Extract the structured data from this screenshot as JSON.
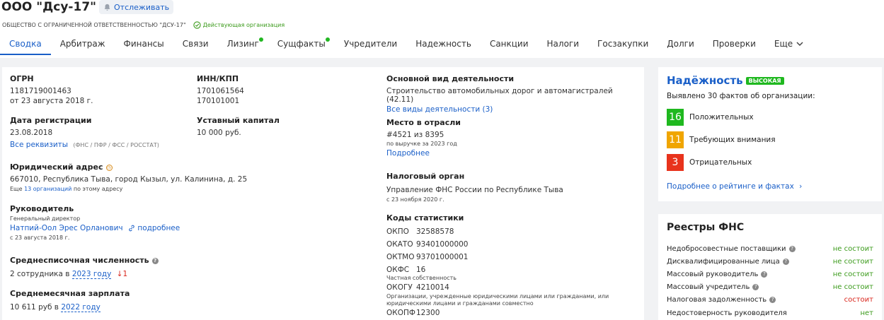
{
  "header": {
    "title": "ООО \"Дсу-17\"",
    "follow_label": "Отслеживать",
    "full_name": "ОБЩЕСТВО С ОГРАНИЧЕННОЙ ОТВЕТСТВЕННОСТЬЮ \"ДСУ-17\"",
    "status": "Действующая организация"
  },
  "tabs": [
    {
      "label": "Сводка",
      "active": true
    },
    {
      "label": "Арбитраж"
    },
    {
      "label": "Финансы"
    },
    {
      "label": "Связи"
    },
    {
      "label": "Лизинг",
      "dot": true
    },
    {
      "label": "Сущфакты",
      "dot": true
    },
    {
      "label": "Учредители"
    },
    {
      "label": "Надежность"
    },
    {
      "label": "Санкции"
    },
    {
      "label": "Налоги"
    },
    {
      "label": "Госзакупки"
    },
    {
      "label": "Долги"
    },
    {
      "label": "Проверки"
    },
    {
      "label": "Еще"
    }
  ],
  "col1": {
    "ogrn_label": "ОГРН",
    "ogrn": "1181719001463",
    "ogrn_date": "от 23 августа 2018 г.",
    "reg_label": "Дата регистрации",
    "reg_date": "23.08.2018",
    "all_requisites": "Все реквизиты",
    "requisites_sources": "(ФНС / ПФР / ФСС / РОССТАТ)",
    "address_label": "Юридический адрес",
    "address": "667010, Республика Тыва, город Кызыл, ул. Калинина, д. 25",
    "address_also_pre": "Еще",
    "address_also_link": "13 организаций",
    "address_also_post": "по этому адресу",
    "head_label": "Руководитель",
    "head_position": "Генеральный директор",
    "head_name": "Натпий-Оол Эрес Орланович",
    "head_more": "подробнее",
    "head_since": "с 23 августа 2018 г.",
    "staff_label": "Среднесписочная численность",
    "staff_value": "2 сотрудника в",
    "staff_year": "2023 году",
    "staff_trend": "↓1",
    "salary_label": "Среднемесячная зарплата",
    "salary_value": "10 611 руб в",
    "salary_year": "2022 году"
  },
  "col2": {
    "inn_label": "ИНН/КПП",
    "inn": "1701061564",
    "kpp": "170101001",
    "capital_label": "Уставный капитал",
    "capital": "10 000 руб."
  },
  "col3": {
    "activity_label": "Основной вид деятельности",
    "activity": "Строительство автомобильных дорог и автомагистралей",
    "activity_code": "(42.11)",
    "all_activities": "Все виды деятельности (3)",
    "rank_label": "Место в отрасли",
    "rank": "#4521 из 8395",
    "rank_note": "по выручке за 2023 год",
    "rank_more": "Подробнее",
    "tax_label": "Налоговый орган",
    "tax_org": "Управление ФНС России по Республике Тыва",
    "tax_since": "с 23 ноября 2020 г.",
    "codes_label": "Коды статистики",
    "codes": [
      {
        "name": "ОКПО",
        "value": "32588578"
      },
      {
        "name": "ОКАТО",
        "value": "93401000000"
      },
      {
        "name": "ОКТМО",
        "value": "93701000001"
      },
      {
        "name": "ОКФС",
        "value": "16"
      },
      {
        "name": "ОКОГУ",
        "value": "4210014"
      },
      {
        "name": "ОКОПФ",
        "value": "12300"
      }
    ],
    "okfs_note": "Частная собственность",
    "okogu_note": "Организации, учрежденные юридическими лицами или гражданами, или юридическими лицами и гражданами совместно"
  },
  "reliability": {
    "title": "Надёжность",
    "badge": "ВЫСОКАЯ",
    "summary": "Выявлено 30 фактов об организации:",
    "rows": [
      {
        "count": "16",
        "label": "Положительных",
        "color": "#1fb81f"
      },
      {
        "count": "11",
        "label": "Требующих внимания",
        "color": "#f0a500"
      },
      {
        "count": "3",
        "label": "Отрицательных",
        "color": "#e8331c"
      }
    ],
    "more": "Подробнее о рейтинге и фактах"
  },
  "registries": {
    "title": "Реестры ФНС",
    "rows": [
      {
        "label": "Недобросовестные поставщики",
        "value": "не состоит",
        "status": "ok"
      },
      {
        "label": "Дисквалифицированные лица",
        "value": "не состоит",
        "status": "ok"
      },
      {
        "label": "Массовый руководитель",
        "value": "не состоит",
        "status": "ok"
      },
      {
        "label": "Массовый учредитель",
        "value": "не состоит",
        "status": "ok"
      },
      {
        "label": "Налоговая задолженность",
        "value": "состоит",
        "status": "bad"
      },
      {
        "label": "Недостоверность руководителя",
        "value": "нет",
        "status": "ok"
      }
    ]
  }
}
